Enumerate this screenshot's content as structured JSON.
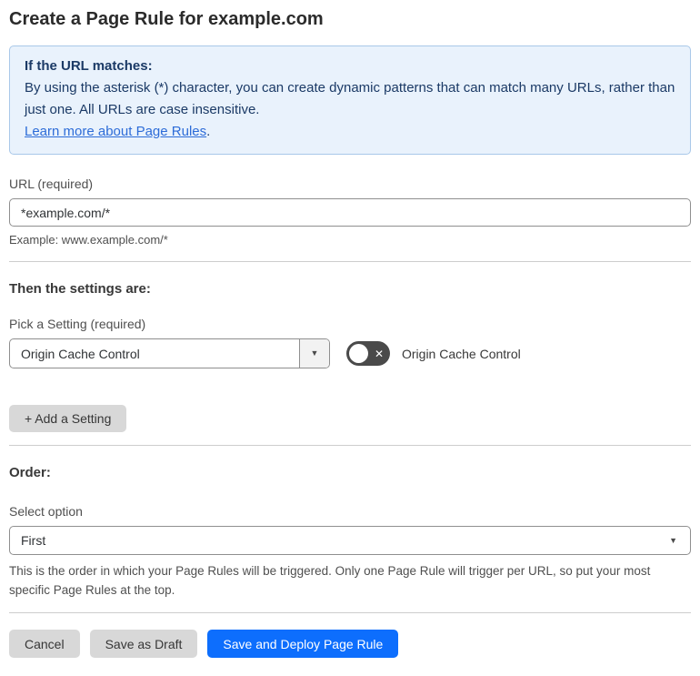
{
  "page": {
    "title": "Create a Page Rule for example.com"
  },
  "info_box": {
    "heading": "If the URL matches:",
    "body": "By using the asterisk (*) character, you can create dynamic patterns that can match many URLs, rather than just one. All URLs are case insensitive.",
    "link_text": "Learn more about Page Rules",
    "link_suffix": "."
  },
  "url_section": {
    "label": "URL (required)",
    "input_value": "*example.com/*",
    "example": "Example: www.example.com/*"
  },
  "settings_section": {
    "heading": "Then the settings are:",
    "pick_label": "Pick a Setting (required)",
    "selected_setting": "Origin Cache Control",
    "dropdown_caret": "▼",
    "toggle_state": "off",
    "toggle_x": "✕",
    "toggle_label": "Origin Cache Control",
    "add_button_label": "+ Add a Setting"
  },
  "order_section": {
    "heading": "Order:",
    "select_label": "Select option",
    "selected_option": "First",
    "dropdown_caret": "▼",
    "helper": "This is the order in which your Page Rules will be triggered. Only one Page Rule will trigger per URL, so put your most specific Page Rules at the top."
  },
  "footer": {
    "cancel_label": "Cancel",
    "save_draft_label": "Save as Draft",
    "save_deploy_label": "Save and Deploy Page Rule"
  },
  "colors": {
    "accent_blue": "#0d6efd",
    "info_background": "#e9f2fc",
    "info_border": "#a9c8e9",
    "info_text": "#1b3a66",
    "link_blue": "#2d6cd8",
    "toggle_off_background": "#4a4a4a",
    "gray_button_background": "#d8d8d8"
  }
}
